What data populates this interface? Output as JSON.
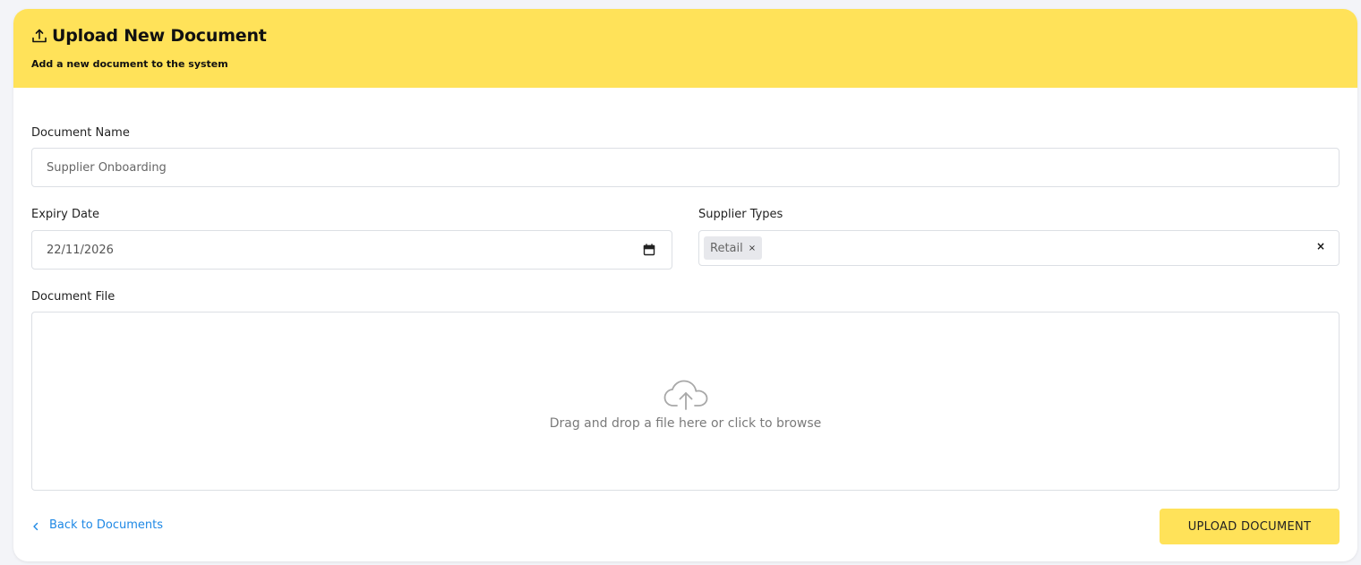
{
  "header": {
    "title": "Upload New Document",
    "subtitle": "Add a new document to the system",
    "icon": "upload-icon",
    "color": "#ffe259"
  },
  "form": {
    "document_name": {
      "label": "Document Name",
      "value": "Supplier Onboarding"
    },
    "expiry_date": {
      "label": "Expiry Date",
      "value": "22/11/2026",
      "icon": "calendar-icon"
    },
    "supplier_types": {
      "label": "Supplier Types",
      "selected": [
        "Retail"
      ],
      "remove_chip_glyph": "×",
      "clear_glyph": "×"
    },
    "document_file": {
      "label": "Document File",
      "dropzone_text": "Drag and drop a file here or click to browse",
      "icon": "cloud-upload-icon"
    }
  },
  "footer": {
    "back_link": "Back to Documents",
    "back_icon": "chevron-left-icon",
    "link_color": "#1e88e5",
    "upload_button": "UPLOAD DOCUMENT"
  }
}
